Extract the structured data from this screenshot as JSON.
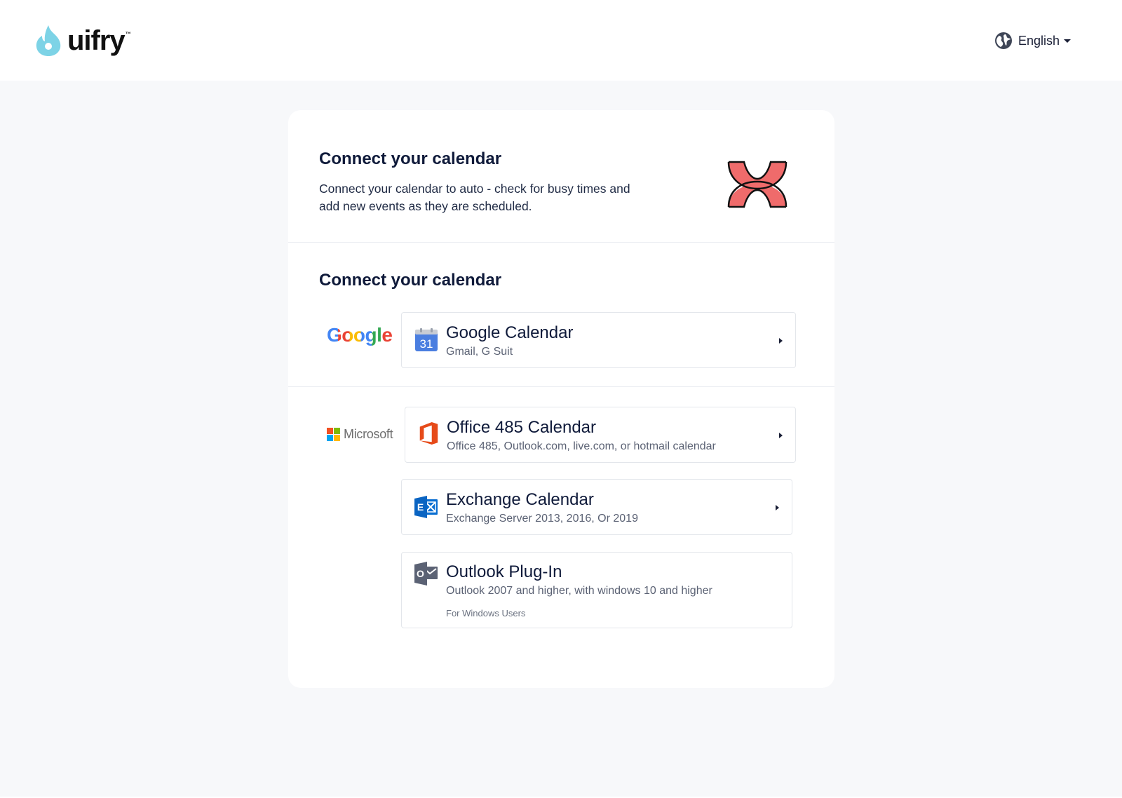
{
  "brand": {
    "name": "uifry",
    "trademark": "™",
    "color": "#7dd3e6"
  },
  "header": {
    "language_label": "English"
  },
  "intro": {
    "title": "Connect your calendar",
    "description": "Connect your calendar to auto - check for busy times and add new events as they are scheduled.",
    "art_color": "#ef6b6b"
  },
  "section": {
    "title": "Connect your calendar"
  },
  "providers": {
    "google": {
      "name": "Google"
    },
    "microsoft": {
      "name": "Microsoft"
    }
  },
  "options": {
    "google_calendar": {
      "title": "Google Calendar",
      "subtitle": "Gmail, G Suit",
      "icon": "google-calendar-icon",
      "icon_text": "31"
    },
    "office_calendar": {
      "title": "Office 485 Calendar",
      "subtitle": "Office 485, Outlook.com, live.com, or hotmail calendar",
      "icon": "office-icon"
    },
    "exchange_calendar": {
      "title": "Exchange Calendar",
      "subtitle": "Exchange Server 2013, 2016, Or 2019",
      "icon": "exchange-icon",
      "icon_text": "E"
    },
    "outlook_plugin": {
      "title": "Outlook Plug-In",
      "subtitle": "Outlook 2007 and higher, with windows 10 and higher",
      "note": "For Windows Users",
      "icon": "outlook-icon",
      "icon_text": "O"
    }
  }
}
